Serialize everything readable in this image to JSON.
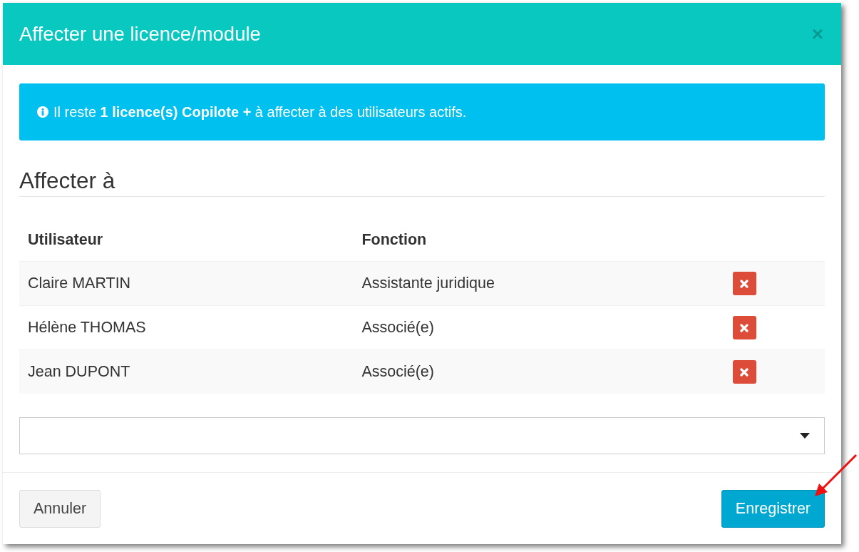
{
  "modal": {
    "title": "Affecter une licence/module",
    "close": "×"
  },
  "alert": {
    "text": "Il reste **1 licence(s) Copilote +** à affecter à des utilisateurs actifs."
  },
  "section": {
    "heading": "Affecter à"
  },
  "table": {
    "columns": [
      "Utilisateur",
      "Fonction"
    ],
    "rows": [
      {
        "cells": [
          "Claire MARTIN",
          "Assistante juridique"
        ]
      },
      {
        "cells": [
          "Hélène THOMAS",
          "Associé(e)"
        ]
      },
      {
        "cells": [
          "Jean DUPONT",
          "Associé(e)"
        ]
      }
    ]
  },
  "user_select": {
    "expanded": false
  },
  "footer": {
    "buttons": [
      {
        "label": "Annuler",
        "kind": "default"
      },
      {
        "label": "Enregistrer",
        "kind": "primary"
      }
    ]
  }
}
